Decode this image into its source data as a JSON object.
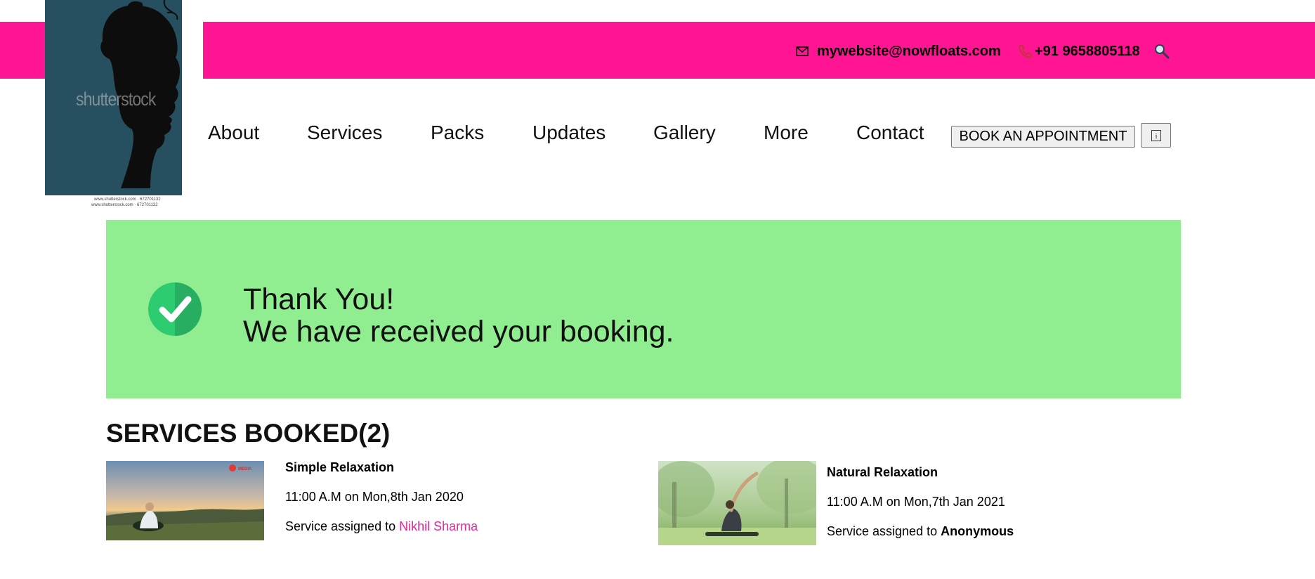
{
  "header": {
    "email": "mywebsite@nowfloats.com",
    "phone": "+91 9658805118",
    "icons": {
      "mail": "envelope-icon",
      "phone": "phone-icon",
      "search": "search-icon"
    },
    "accent_color": "#ff1493"
  },
  "logo": {
    "watermark": "shutterstock",
    "caption_1": "www.shutterstock.com · 672701132",
    "caption_2": "www.shutterstock.com · 672701132"
  },
  "nav": {
    "items": [
      "About",
      "Services",
      "Packs",
      "Updates",
      "Gallery",
      "More",
      "Contact"
    ],
    "book_button": "BOOK AN APPOINTMENT",
    "info_button_icon": "info-icon"
  },
  "banner": {
    "line1": "Thank You!",
    "line2": "We have received your booking.",
    "bg_color": "#90ee90",
    "check_color": "#27ae60"
  },
  "services": {
    "title": "SERVICES BOOKED(2)",
    "items": [
      {
        "name": "Simple Relaxation",
        "time": "11:00 A.M on Mon,8th Jan 2020",
        "assigned_prefix": "Service assigned to ",
        "assignee": "Nikhil Sharma",
        "image_logo": "MEDIA"
      },
      {
        "name": "Natural Relaxation",
        "time": "11:00 A.M on Mon,7th Jan 2021",
        "assigned_prefix": "Service assigned to ",
        "assignee": "Anonymous"
      }
    ]
  }
}
